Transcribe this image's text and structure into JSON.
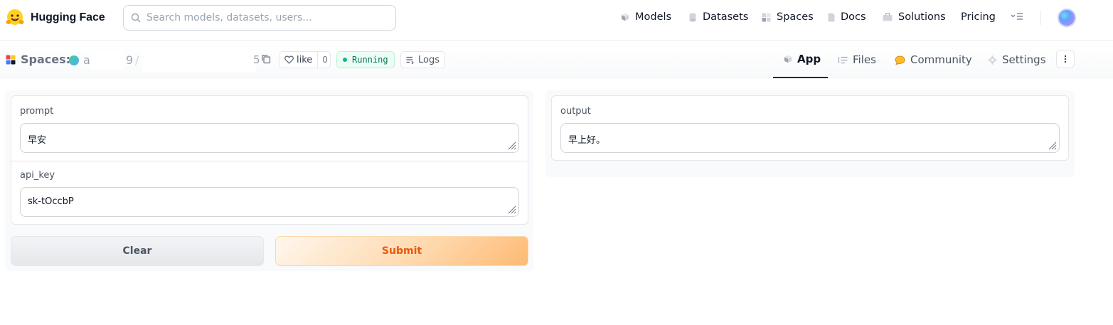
{
  "brand": {
    "name": "Hugging Face",
    "logo_icon": "hugging-face-emoji"
  },
  "search": {
    "placeholder": "Search models, datasets, users..."
  },
  "nav": {
    "items": [
      {
        "label": "Models",
        "icon": "cube-icon"
      },
      {
        "label": "Datasets",
        "icon": "database-icon"
      },
      {
        "label": "Spaces",
        "icon": "grid-icon"
      },
      {
        "label": "Docs",
        "icon": "doc-icon"
      },
      {
        "label": "Solutions",
        "icon": "briefcase-icon"
      },
      {
        "label": "Pricing"
      }
    ]
  },
  "space": {
    "label": "Spaces:",
    "owner_prefix": "a",
    "owner_suffix": "9",
    "separator": "/",
    "name_suffix": "5",
    "like_label": "like",
    "like_count": "0",
    "status": "Running",
    "logs_label": "Logs"
  },
  "tabs": [
    {
      "label": "App",
      "active": true
    },
    {
      "label": "Files"
    },
    {
      "label": "Community"
    },
    {
      "label": "Settings"
    }
  ],
  "app": {
    "inputs": {
      "prompt": {
        "label": "prompt",
        "value": "早安"
      },
      "api_key": {
        "label": "api_key",
        "value": "sk-tOccbP"
      }
    },
    "buttons": {
      "clear": "Clear",
      "submit": "Submit"
    },
    "output": {
      "label": "output",
      "value": "早上好。"
    }
  },
  "colors": {
    "accent_orange": "#ea580c",
    "status_green": "#047857",
    "border": "#e5e7eb"
  }
}
